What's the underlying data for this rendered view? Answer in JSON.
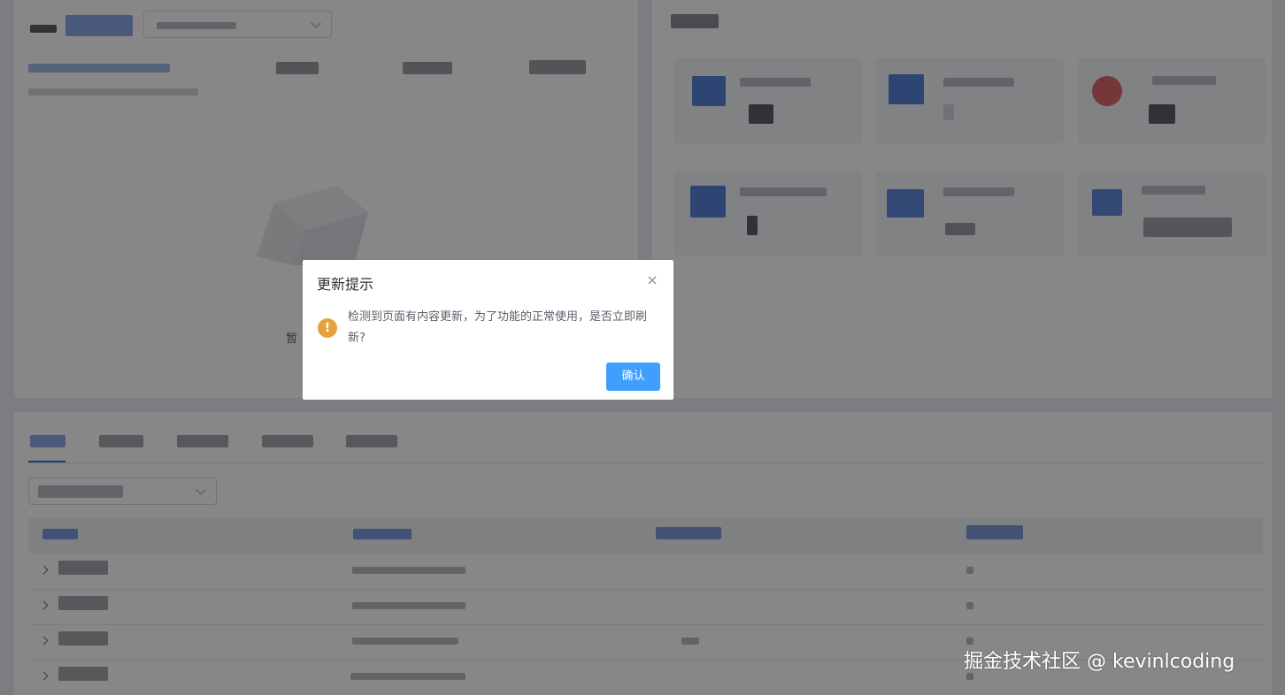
{
  "background": {
    "empty_state_text": "暂"
  },
  "dialog": {
    "title": "更新提示",
    "close_label": "×",
    "message": "检测到页面有内容更新，为了功能的正常使用，是否立即刷新?",
    "warning_glyph": "!",
    "confirm_label": "确认"
  },
  "watermark": {
    "text": "掘金技术社区 @ kevinlcoding"
  },
  "colors": {
    "mask": "rgba(0,0,0,0.47)",
    "primary": "#409eff",
    "warning": "#e6a23c"
  },
  "icons": {
    "warning": "exclamation-circle-icon",
    "close": "close-icon",
    "chevron": "chevron-down-icon",
    "row_expand": "chevron-right-icon"
  }
}
